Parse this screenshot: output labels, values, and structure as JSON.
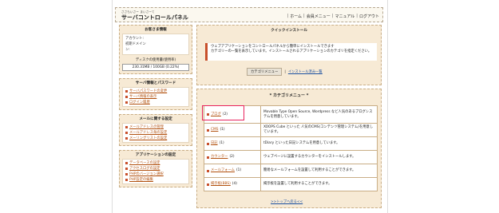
{
  "header": {
    "logo_sub": "ささもいさー まいさーて",
    "logo_main": "サーバコントロールパネル",
    "nav": [
      "ホーム",
      "会員メニュー",
      "マニュアル",
      "ログアウト"
    ]
  },
  "sidebar": {
    "customer_box": {
      "title": "お客さま情報",
      "account_label": "アカウント:",
      "initial_domain_label": "初期ドメイン",
      "initial_domain_label2": "ン:",
      "disk_label": "ディスクの使用量(使用率)",
      "disk_value": "230.31MB / 100GB (0.22%)"
    },
    "server_box": {
      "title": "サーバ情報とパスワード",
      "links": [
        "サーバパスワードの変更",
        "サーバ情報の表示",
        "ログイン履歴"
      ]
    },
    "mail_box": {
      "title": "メールに関する設定",
      "links": [
        "メールアドレスの管理",
        "メールアドレス毎の設定",
        "メーリングリストの設定"
      ]
    },
    "app_box": {
      "title": "アプリケーションの設定",
      "links": [
        "データベースの設定",
        "アクセスログの設定",
        "PHPのバージョン選択",
        "PHP設定の編集"
      ]
    }
  },
  "quick_install": {
    "title": "クイックインストール",
    "description": "ウェブアプリケーションをコントロールパネルから簡単にインストールできます\nカテゴリーの一覧を表示しています。インストールされるアプリケーションのカテゴリを指定ください。",
    "category_menu_button": "カテゴリメニュー",
    "installed_link": "インストール済み一覧"
  },
  "category_menu": {
    "title": "* カテゴリメニュー *",
    "rows": [
      {
        "name": "ブログ",
        "count": "(2)",
        "desc": "Movable Type Open Source, Wordpress など人気のあるブログシステムを用意しています。"
      },
      {
        "name": "CMS",
        "count": "(1)",
        "desc": "XOOPS Cube といった 人気のCMS(コンテンツ管理システム)を用意しています。"
      },
      {
        "name": "日記",
        "count": "(1)",
        "desc": "tDiary といった日記システムを用意しています。"
      },
      {
        "name": "カウンター",
        "count": "(2)",
        "desc": "ウェブページに設置するカウンターをインストールします。"
      },
      {
        "name": "メールフォーム",
        "count": "(1)",
        "desc": "簡易なメールフォームを設置して利用することができます。"
      },
      {
        "name": "掲示板(BBS)",
        "count": "(4)",
        "desc": "掲示板を設置して利用することができます。"
      }
    ],
    "to_top": ">>トップへ戻る<<"
  }
}
